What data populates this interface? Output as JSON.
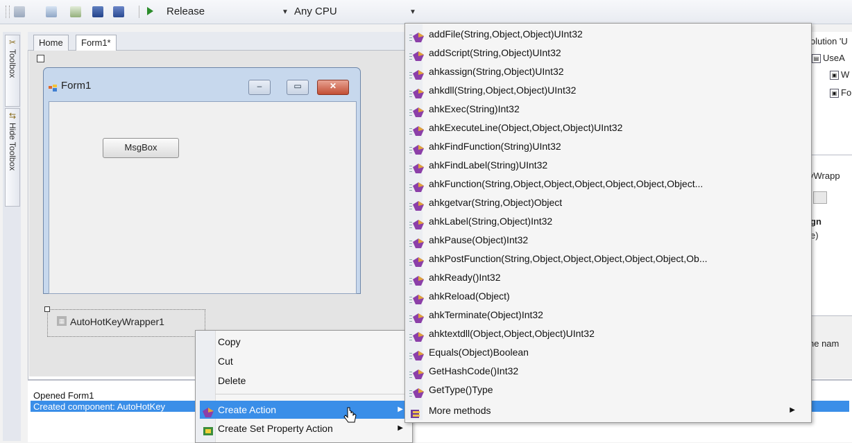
{
  "toolbar": {
    "configuration": "Release",
    "platform": "Any CPU"
  },
  "left_toolbox": {
    "toolbox_label": "Toolbox",
    "hide_toolbox_label": "Hide Toolbox"
  },
  "tabs": [
    "Home",
    "Form1*"
  ],
  "form": {
    "title": "Form1",
    "button_label": "MsgBox",
    "min_glyph": "–",
    "max_glyph": "▭",
    "close_glyph": "✕"
  },
  "component": {
    "label": "AutoHotKeyWrapper1"
  },
  "output": {
    "line1": "Opened Form1",
    "line2": "Created component: AutoHotKey"
  },
  "context_menu": {
    "items": [
      {
        "label": "Copy",
        "has_submenu": false,
        "highlighted": false
      },
      {
        "label": "Cut",
        "has_submenu": false,
        "highlighted": false
      },
      {
        "label": "Delete",
        "has_submenu": false,
        "highlighted": false
      },
      {
        "label": "Create Action",
        "has_submenu": true,
        "highlighted": true
      },
      {
        "label": "Create Set Property Action",
        "has_submenu": true,
        "highlighted": false
      }
    ]
  },
  "methods_menu": {
    "items": [
      "addFile(String,Object,Object)UInt32",
      "addScript(String,Object)UInt32",
      "ahkassign(String,Object)UInt32",
      "ahkdll(String,Object,Object)UInt32",
      "ahkExec(String)Int32",
      "ahkExecuteLine(Object,Object,Object)UInt32",
      "ahkFindFunction(String)UInt32",
      "ahkFindLabel(String)UInt32",
      "ahkFunction(String,Object,Object,Object,Object,Object,Object...",
      "ahkgetvar(String,Object)Object",
      "ahkLabel(String,Object)Int32",
      "ahkPause(Object)Int32",
      "ahkPostFunction(String,Object,Object,Object,Object,Object,Ob...",
      "ahkReady()Int32",
      "ahkReload(Object)",
      "ahkTerminate(Object)Int32",
      "ahktextdll(Object,Object,Object)UInt32",
      "Equals(Object)Boolean",
      "GetHashCode()Int32",
      "GetType()Type"
    ],
    "more_label": "More methods"
  },
  "right_panel": {
    "solution_text": "olution 'U",
    "project_text": "UseA",
    "tree_item1": "W",
    "tree_item2": "Fo",
    "properties_text": "yWrapp",
    "bold_text": "gn",
    "paren_text": "e)",
    "desc_text": "he nam"
  }
}
